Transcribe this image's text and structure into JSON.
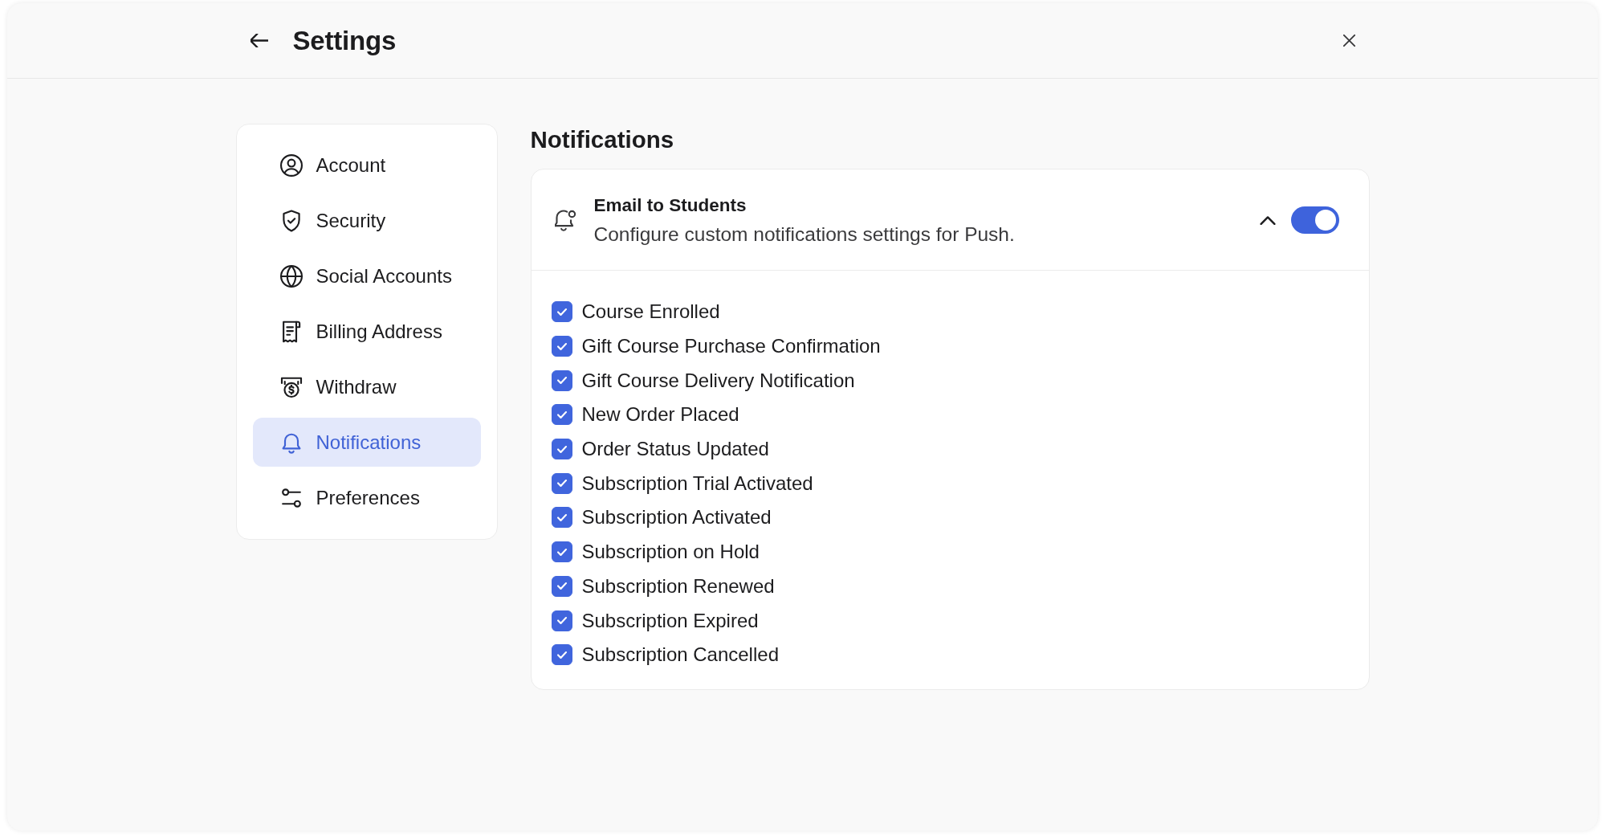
{
  "header": {
    "title": "Settings"
  },
  "sidebar": {
    "items": [
      {
        "label": "Account",
        "selected": false
      },
      {
        "label": "Security",
        "selected": false
      },
      {
        "label": "Social Accounts",
        "selected": false
      },
      {
        "label": "Billing Address",
        "selected": false
      },
      {
        "label": "Withdraw",
        "selected": false
      },
      {
        "label": "Notifications",
        "selected": true
      },
      {
        "label": "Preferences",
        "selected": false
      }
    ]
  },
  "content": {
    "title": "Notifications",
    "section": {
      "title": "Email to Students",
      "description": "Configure custom notifications settings for Push.",
      "expanded": true,
      "enabled": true,
      "options": [
        {
          "label": "Course Enrolled",
          "checked": true
        },
        {
          "label": "Gift Course Purchase Confirmation",
          "checked": true
        },
        {
          "label": "Gift Course Delivery Notification",
          "checked": true
        },
        {
          "label": "New Order Placed",
          "checked": true
        },
        {
          "label": "Order Status Updated",
          "checked": true
        },
        {
          "label": "Subscription Trial Activated",
          "checked": true
        },
        {
          "label": "Subscription Activated",
          "checked": true
        },
        {
          "label": "Subscription on Hold",
          "checked": true
        },
        {
          "label": "Subscription Renewed",
          "checked": true
        },
        {
          "label": "Subscription Expired",
          "checked": true
        },
        {
          "label": "Subscription Cancelled",
          "checked": true
        }
      ]
    }
  }
}
